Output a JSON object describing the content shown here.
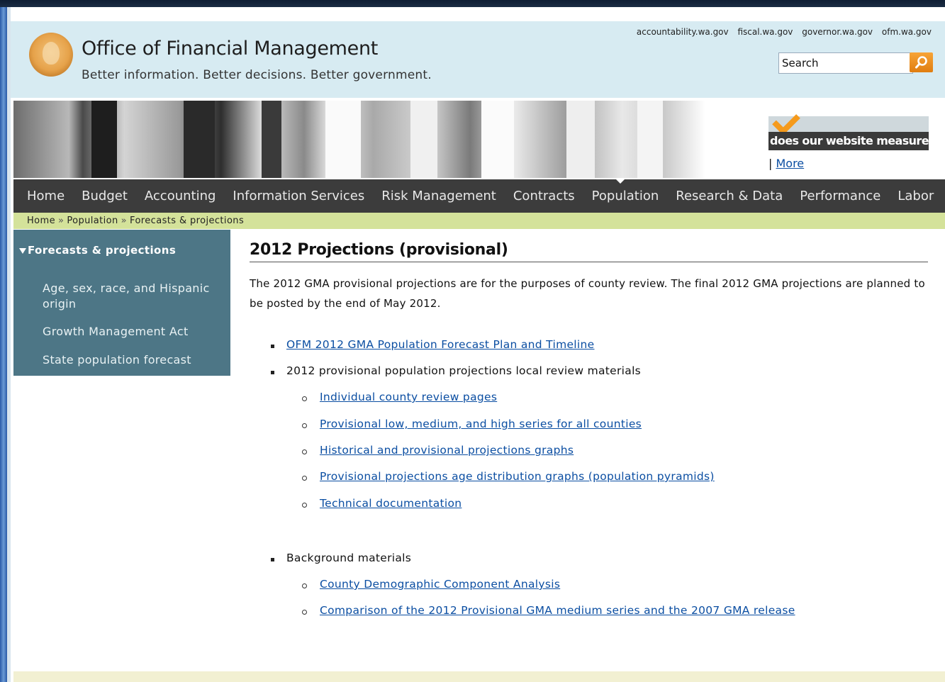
{
  "header": {
    "title": "Office of Financial Management",
    "tagline": "Better information. Better decisions. Better government.",
    "top_links": [
      "accountability.wa.gov",
      "fiscal.wa.gov",
      "governor.wa.gov",
      "ofm.wa.gov"
    ],
    "search_placeholder": "Search"
  },
  "survey": {
    "label": "does our website measure up",
    "more_prefix": "| ",
    "more": "More"
  },
  "nav": {
    "items": [
      "Home",
      "Budget",
      "Accounting",
      "Information Services",
      "Risk Management",
      "Contracts",
      "Population",
      "Research & Data",
      "Performance",
      "Labor"
    ]
  },
  "breadcrumb": {
    "items": [
      "Home",
      "Population",
      "Forecasts & projections"
    ],
    "separator": "»"
  },
  "sidebar": {
    "heading": "Forecasts & projections",
    "items": [
      "Age, sex, race, and Hispanic origin",
      "Growth Management Act",
      "State population forecast"
    ]
  },
  "main": {
    "title": "2012 Projections (provisional)",
    "intro": "The 2012 GMA provisional projections are for the purposes of county review. The final 2012 GMA projections are planned to be posted by the end of May 2012.",
    "list": {
      "link1": "OFM 2012 GMA Population Forecast Plan and Timeline",
      "item2": "2012 provisional population projections local review materials",
      "sub2": [
        "Individual county review pages",
        "Provisional low, medium, and high series for all counties",
        "Historical and provisional projections graphs",
        "Provisional projections age distribution graphs (population pyramids)",
        "Technical documentation"
      ],
      "item3": "Background materials",
      "sub3": [
        "County Demographic Component Analysis",
        "Comparison of the 2012 Provisional GMA medium series and the 2007 GMA release"
      ]
    }
  }
}
